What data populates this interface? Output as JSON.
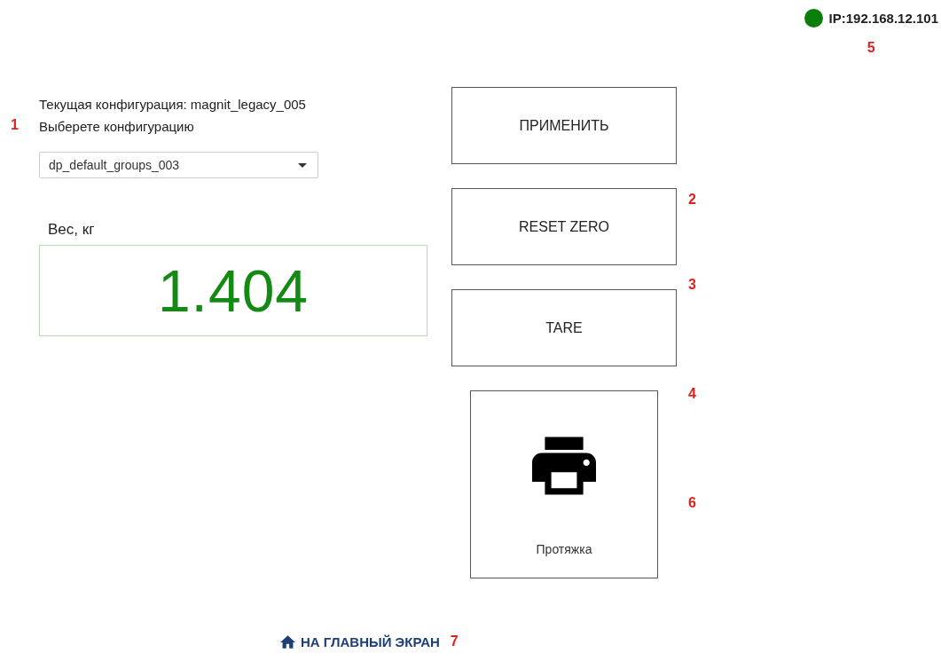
{
  "status": {
    "connected": true,
    "ip": "IP:192.168.12.101",
    "marker": "5"
  },
  "config": {
    "marker": "1",
    "current": "Текущая конфигурация: magnit_legacy_005",
    "prompt": "Выберете конфигурацию",
    "select": {
      "value": "dp_default_groups_003"
    }
  },
  "weight": {
    "label": "Вес, кг",
    "value": "1.404"
  },
  "buttons": [
    {
      "kind": "text",
      "label": "ПРИМЕНИТЬ"
    },
    {
      "kind": "text",
      "label": "RESET ZERO",
      "markers": [
        "2"
      ]
    },
    {
      "kind": "text",
      "label": "TARE",
      "markers": [
        "3"
      ]
    },
    {
      "kind": "print",
      "label": "Протяжка",
      "markers": [
        "4",
        "6"
      ]
    }
  ],
  "home_link": {
    "label": "НА ГЛАВНЫЙ ЭКРАН",
    "marker": "7"
  }
}
